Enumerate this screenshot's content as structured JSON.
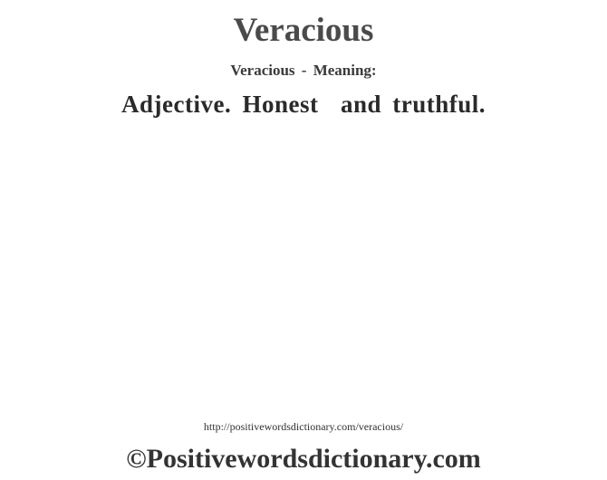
{
  "word": "Veracious",
  "subtitle": "Veracious - Meaning:",
  "definition": "Adjective. Honest  and truthful.",
  "url": "http://positivewordsdictionary.com/veracious/",
  "copyright": "©Positivewordsdictionary.com"
}
